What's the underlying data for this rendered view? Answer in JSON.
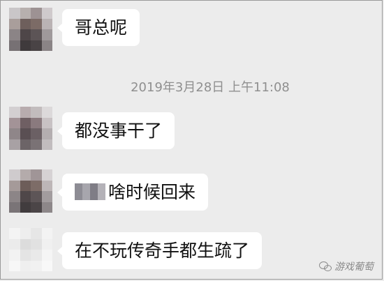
{
  "messages": [
    {
      "text": "哥总呢"
    },
    {
      "text": "都没事干了"
    },
    {
      "text": "啥时候回来"
    },
    {
      "text": "在不玩传奇手都生疏了"
    }
  ],
  "timestamp": "2019年3月28日 上午11:08",
  "watermark": "游戏葡萄"
}
